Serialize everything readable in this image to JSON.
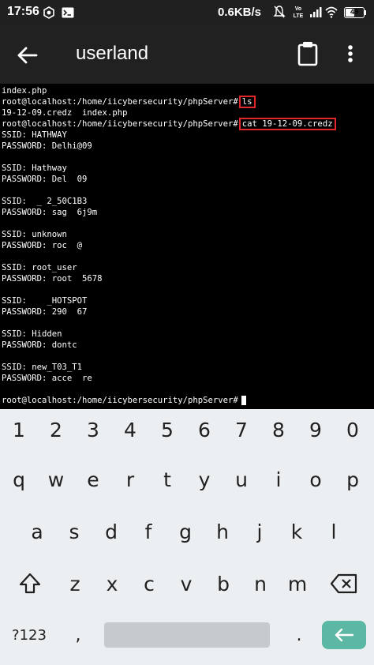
{
  "status_bar": {
    "time": "17:56",
    "net_speed": "0.6KB/s",
    "volte_label": "Vo LTE",
    "battery_level": "49",
    "battery_fraction": 0.49,
    "icons": [
      "hexagon-app-icon",
      "terminal-app-icon",
      "mute-icon",
      "volte-icon",
      "signal-icon",
      "signal-icon-2",
      "wifi-icon",
      "battery-icon"
    ]
  },
  "app_bar": {
    "title": "userland",
    "back_icon": "arrow-back-icon",
    "clipboard_icon": "clipboard-icon",
    "more_icon": "more-vert-icon"
  },
  "terminal": {
    "highlight_color": "#e3262b",
    "lines": [
      {
        "text": "index.php"
      },
      {
        "prompt": "root@localhost:/home/iicybersecurity/phpServer#",
        "cmd": "ls"
      },
      {
        "text": "19-12-09.credz  index.php"
      },
      {
        "prompt": "root@localhost:/home/iicybersecurity/phpServer#",
        "cmd": "cat 19-12-09.credz"
      },
      {
        "text": "SSID: HATHWAY"
      },
      {
        "text": "PASSWORD: Delhi@09"
      },
      {
        "text": ""
      },
      {
        "text": "SSID: Hathway"
      },
      {
        "text": "PASSWORD: Del  09"
      },
      {
        "text": ""
      },
      {
        "text": "SSID:  _ 2_50C1B3"
      },
      {
        "text": "PASSWORD: sag  6j9m"
      },
      {
        "text": ""
      },
      {
        "text": "SSID: unknown"
      },
      {
        "text": "PASSWORD: roc  @"
      },
      {
        "text": ""
      },
      {
        "text": "SSID: root_user"
      },
      {
        "text": "PASSWORD: root  5678"
      },
      {
        "text": ""
      },
      {
        "text": "SSID:    _HOTSPOT"
      },
      {
        "text": "PASSWORD: 290  67"
      },
      {
        "text": ""
      },
      {
        "text": "SSID: Hidden"
      },
      {
        "text": "PASSWORD: dontc"
      },
      {
        "text": ""
      },
      {
        "text": "SSID: new_T03_T1"
      },
      {
        "text": "PASSWORD: acce  re"
      },
      {
        "text": ""
      },
      {
        "prompt": "root@localhost:/home/iicybersecurity/phpServer#",
        "cursor": true
      }
    ]
  },
  "keyboard": {
    "row_numbers": [
      "1",
      "2",
      "3",
      "4",
      "5",
      "6",
      "7",
      "8",
      "9",
      "0"
    ],
    "row_top": [
      "q",
      "w",
      "e",
      "r",
      "t",
      "y",
      "u",
      "i",
      "o",
      "p"
    ],
    "row_middle": [
      "a",
      "s",
      "d",
      "f",
      "g",
      "h",
      "j",
      "k",
      "l"
    ],
    "row_bottom": [
      "z",
      "x",
      "c",
      "v",
      "b",
      "n",
      "m"
    ],
    "symbols_label": "?123",
    "comma": ",",
    "period": ".",
    "shift_icon": "shift-icon",
    "delete_icon": "backspace-icon",
    "enter_icon": "enter-icon",
    "enter_color": "#5cb8a4"
  }
}
